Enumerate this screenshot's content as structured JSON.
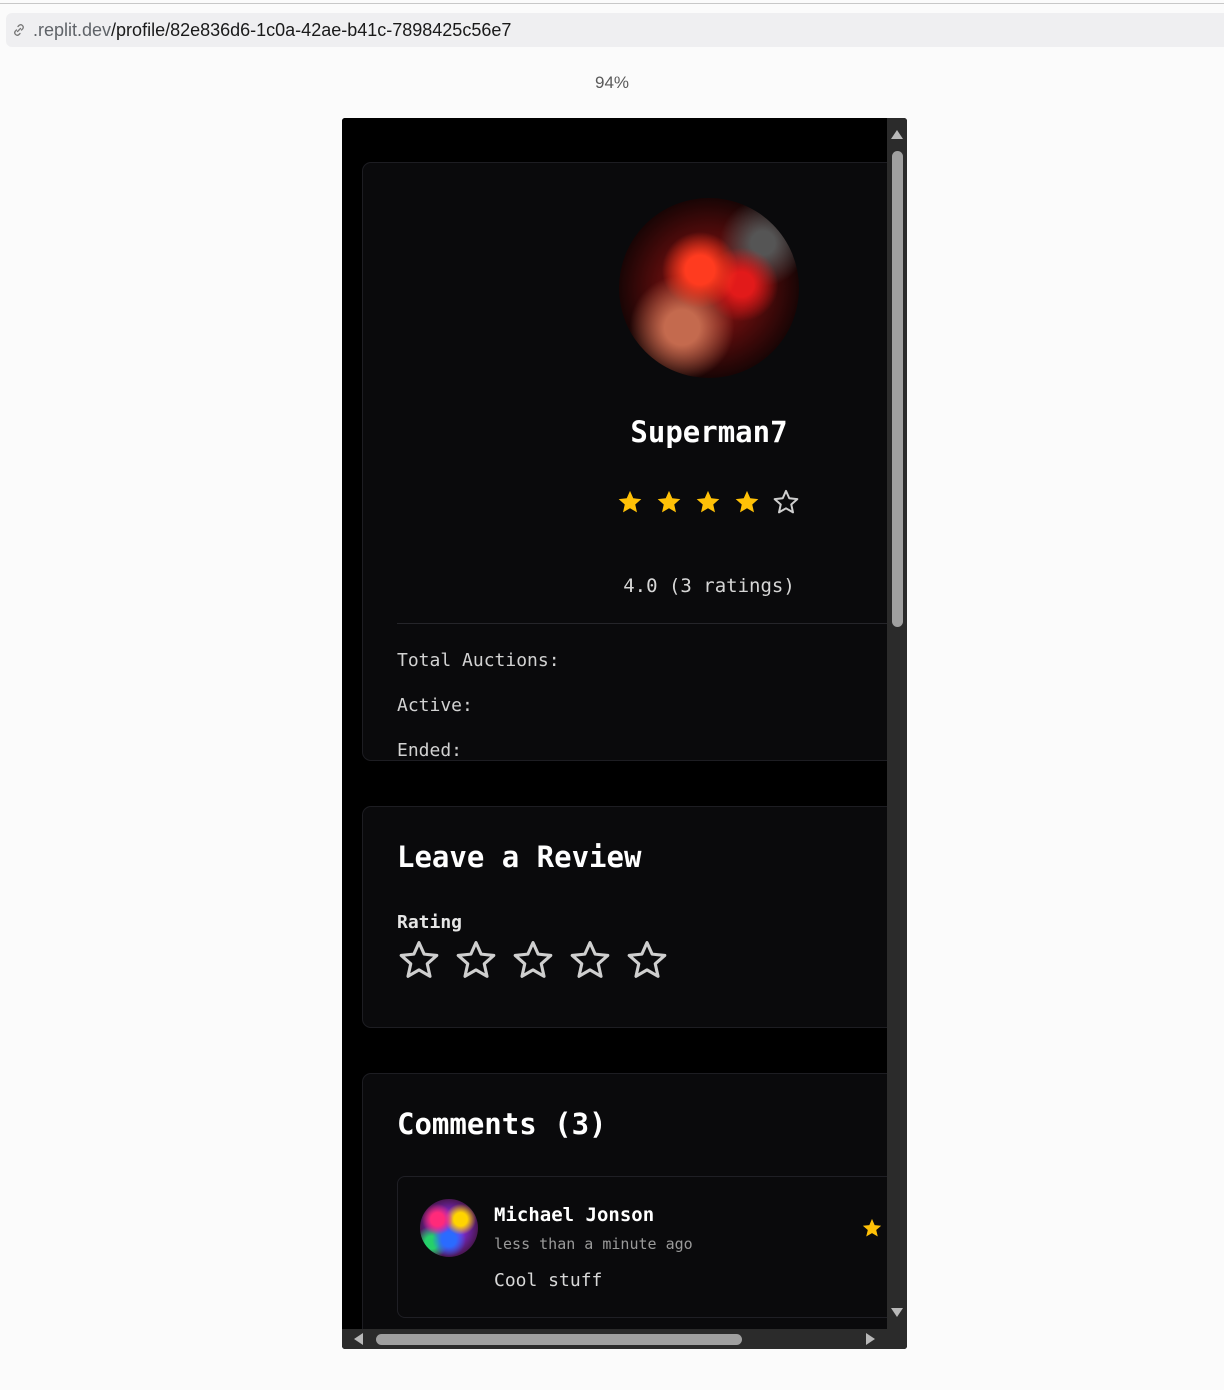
{
  "browser": {
    "url_host": ".replit.dev",
    "url_path": "/profile/82e836d6-1c0a-42ae-b41c-7898425c56e7",
    "zoom": "94%"
  },
  "profile": {
    "username": "Superman7",
    "rating_value": 4.0,
    "rating_max": 5,
    "rating_text": "4.0 (3 ratings)",
    "stats": [
      {
        "label": "Total Auctions:",
        "value": ""
      },
      {
        "label": "Active:",
        "value": ""
      },
      {
        "label": "Ended:",
        "value": ""
      }
    ]
  },
  "review": {
    "title": "Leave a Review",
    "rating_label": "Rating",
    "selected_rating": 0,
    "max_rating": 5
  },
  "comments": {
    "title": "Comments (3)",
    "items": [
      {
        "author": "Michael Jonson",
        "time": "less than a minute ago",
        "text": "Cool stuff",
        "rating": 1
      }
    ]
  },
  "colors": {
    "star_filled": "#ffc107",
    "star_empty": "#cfcfcf",
    "card_bg": "#0a0a0c",
    "page_bg": "#000000"
  }
}
